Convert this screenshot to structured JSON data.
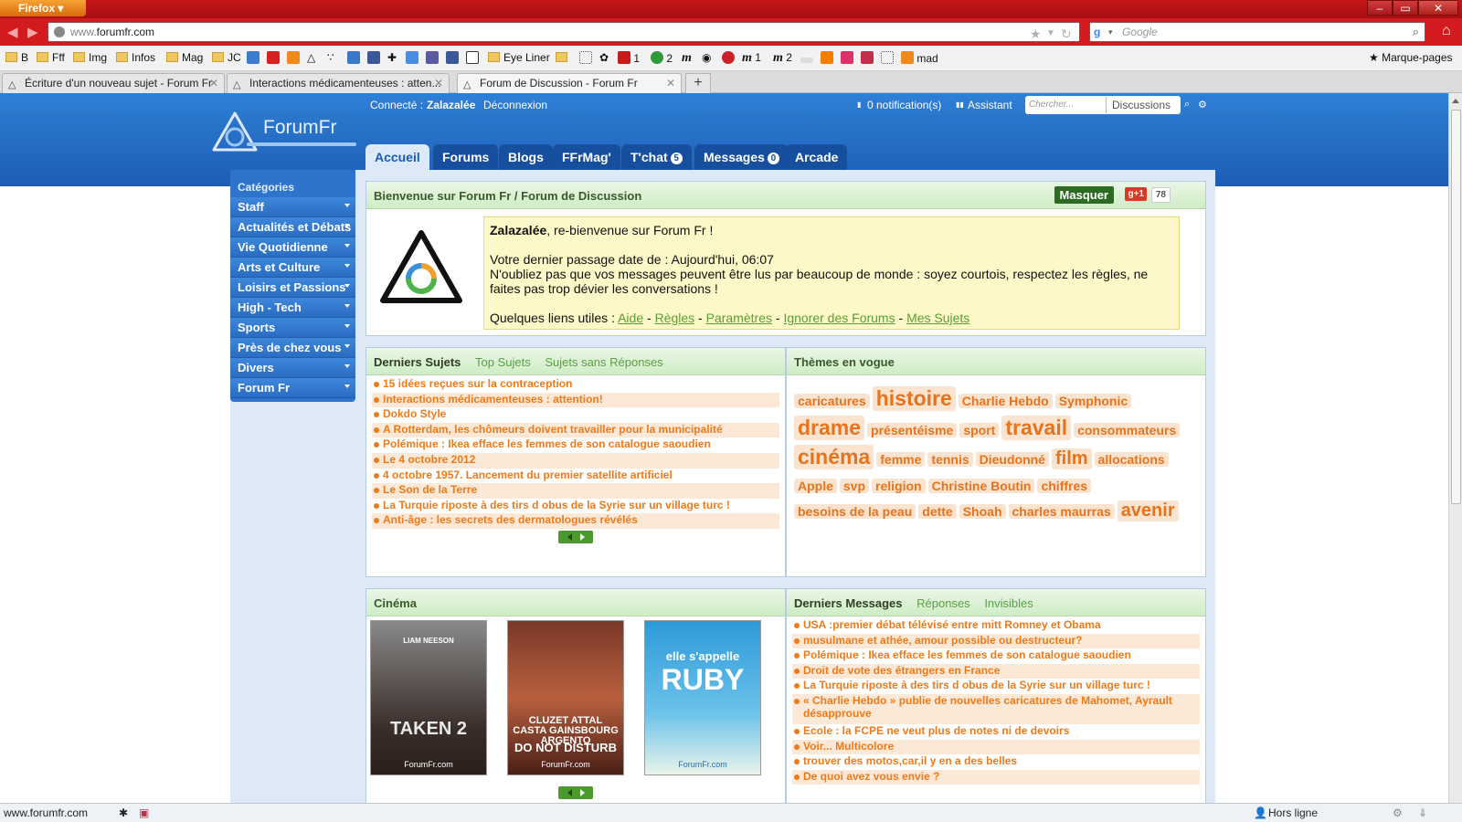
{
  "browser": {
    "app_button": "Firefox",
    "url_host_prefix": "www.",
    "url_host": "forumfr.com",
    "search_placeholder": "Google",
    "bookmarks": [
      {
        "label": "B"
      },
      {
        "label": "Fff"
      },
      {
        "label": "Img"
      },
      {
        "label": "Infos"
      },
      {
        "label": "Mag"
      },
      {
        "label": "JC"
      },
      {
        "label": "Eye Liner"
      },
      {
        "label": "1"
      },
      {
        "label": "2"
      },
      {
        "label": "1"
      },
      {
        "label": "2"
      },
      {
        "label": "mad"
      }
    ],
    "bookmarks_menu": "Marque-pages",
    "tabs": [
      {
        "title": "Écriture d'un nouveau sujet - Forum Fr"
      },
      {
        "title": "Interactions médicamenteuses : atten..."
      },
      {
        "title": "Forum de Discussion - Forum Fr"
      }
    ],
    "status_url": "www.forumfr.com",
    "status_right": "Hors ligne"
  },
  "forum": {
    "logo_text": "ForumFr",
    "user_bar": {
      "connected_label": "Connecté :",
      "username": "Zalazalée",
      "logout": "Déconnexion",
      "notifications": "0 notification(s)",
      "assistant": "Assistant",
      "search_placeholder": "Chercher...",
      "search_scope": "Discussions"
    },
    "nav_tabs": [
      {
        "label": "Accueil"
      },
      {
        "label": "Forums"
      },
      {
        "label": "Blogs"
      },
      {
        "label": "FFrMag'"
      },
      {
        "label": "T'chat",
        "badge": "5"
      },
      {
        "label": "Messages",
        "badge": "0"
      },
      {
        "label": "Arcade"
      }
    ],
    "sidebar": {
      "title": "Catégories",
      "items": [
        {
          "label": "Staff"
        },
        {
          "label": "Actualités et Débats"
        },
        {
          "label": "Vie Quotidienne"
        },
        {
          "label": "Arts et Culture"
        },
        {
          "label": "Loisirs et Passions"
        },
        {
          "label": "High - Tech"
        },
        {
          "label": "Sports"
        },
        {
          "label": "Près de chez vous"
        },
        {
          "label": "Divers"
        },
        {
          "label": "Forum Fr"
        }
      ]
    },
    "welcome": {
      "header": "Bienvenue sur Forum Fr / Forum de Discussion",
      "hide_button": "Masquer",
      "gplus": "+1",
      "gplus_count": "78",
      "username": "Zalazalée",
      "greeting": ", re-bienvenue sur Forum Fr !",
      "last_visit": "Votre dernier passage date de : Aujourd'hui, 06:07",
      "notice": "N'oubliez pas que vos messages peuvent être lus par beaucoup de monde : soyez courtois, respectez les règles, ne faites pas trop dévier les conversations !",
      "links_label": "Quelques liens utiles :",
      "links": [
        "Aide",
        "Règles",
        "Paramètres",
        "Ignorer des Forums",
        "Mes Sujets"
      ]
    },
    "latest_topics": {
      "tabs": [
        "Derniers Sujets",
        "Top Sujets",
        "Sujets sans Réponses"
      ],
      "items": [
        "15 idées reçues sur la contraception",
        "Interactions médicamenteuses : attention!",
        "Dokdo Style",
        "A Rotterdam, les chômeurs doivent travailler pour la municipalité",
        "Polémique : Ikea efface les femmes de son catalogue saoudien",
        "Le 4 octobre 2012",
        "4 octobre 1957. Lancement du premier satellite artificiel",
        "Le Son de la Terre",
        "La Turquie riposte à des tirs d obus de la Syrie sur un village turc !",
        "Anti-âge : les secrets des dermatologues révélés"
      ]
    },
    "trending": {
      "title": "Thèmes en vogue",
      "tags": [
        {
          "label": "caricatures",
          "size": 2
        },
        {
          "label": "histoire",
          "size": 4
        },
        {
          "label": "Charlie Hebdo",
          "size": 2
        },
        {
          "label": "Symphonic",
          "size": 2
        },
        {
          "label": "drame",
          "size": 4
        },
        {
          "label": "présentéisme",
          "size": 2
        },
        {
          "label": "sport",
          "size": 2
        },
        {
          "label": "travail",
          "size": 4
        },
        {
          "label": "consommateurs",
          "size": 2
        },
        {
          "label": "cinéma",
          "size": 4
        },
        {
          "label": "femme",
          "size": 2
        },
        {
          "label": "tennis",
          "size": 2
        },
        {
          "label": "Dieudonné",
          "size": 2
        },
        {
          "label": "film",
          "size": 3
        },
        {
          "label": "allocations",
          "size": 2
        },
        {
          "label": "Apple",
          "size": 2
        },
        {
          "label": "svp",
          "size": 2
        },
        {
          "label": "religion",
          "size": 2
        },
        {
          "label": "Christine Boutin",
          "size": 2
        },
        {
          "label": "chiffres",
          "size": 2
        },
        {
          "label": "besoins de la peau",
          "size": 2
        },
        {
          "label": "dette",
          "size": 2
        },
        {
          "label": "Shoah",
          "size": 2
        },
        {
          "label": "charles maurras",
          "size": 2
        },
        {
          "label": "avenir",
          "size": 3
        }
      ]
    },
    "cinema": {
      "title": "Cinéma",
      "posters": [
        {
          "top": "LIAM NEESON",
          "title": "TAKEN 2",
          "footer": "ForumFr.com"
        },
        {
          "top": "CLUZET ATTAL CASTA GAINSBOURG ARGENTO",
          "title": "DO NOT DISTURB",
          "footer": "ForumFr.com"
        },
        {
          "top": "elle s'appelle",
          "title": "RUBY",
          "footer": "ForumFr.com"
        }
      ]
    },
    "latest_messages": {
      "tabs": [
        "Derniers Messages",
        "Réponses",
        "Invisibles"
      ],
      "items": [
        "USA :premier débat télévisé entre mitt Romney et Obama",
        "musulmane et athée, amour possible ou destructeur?",
        "Polémique : Ikea efface les femmes de son catalogue saoudien",
        "Droit de vote des étrangers en France",
        "La Turquie riposte à des tirs d obus de la Syrie sur un village turc !",
        "« Charlie Hebdo » publie de nouvelles caricatures de Mahomet, Ayrault désapprouve",
        "Ecole : la FCPE ne veut plus de notes ni de devoirs",
        "Voir... Multicolore",
        "trouver des motos,car,il y en a des belles",
        "De quoi avez vous envie ?"
      ]
    }
  }
}
